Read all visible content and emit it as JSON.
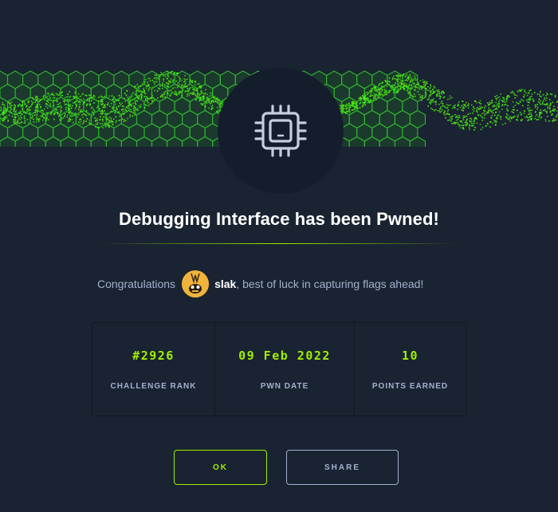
{
  "modal": {
    "title": "Debugging Interface has been Pwned!",
    "congrats_prefix": "Congratulations",
    "username": "slak",
    "congrats_suffix": ", best of luck in capturing flags ahead!",
    "icons": {
      "banner": "green-hexagon-wave-banner",
      "main": "cpu-chip-icon",
      "avatar": "user-avatar"
    },
    "stats": [
      {
        "value": "#2926",
        "label": "CHALLENGE RANK"
      },
      {
        "value": "09 Feb 2022",
        "label": "PWN DATE"
      },
      {
        "value": "10",
        "label": "POINTS EARNED"
      }
    ],
    "buttons": {
      "ok": "OK",
      "share": "SHARE"
    }
  },
  "colors": {
    "background": "#1a2332",
    "accent": "#9fef00",
    "muted_text": "#a4b1cd",
    "avatar": "#f0b43c"
  }
}
